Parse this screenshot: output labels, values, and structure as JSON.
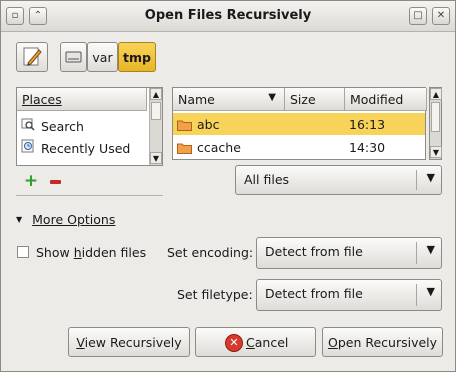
{
  "window": {
    "title": "Open Files Recursively"
  },
  "path_bar": {
    "buttons": [
      "var",
      "tmp"
    ]
  },
  "places": {
    "header": "Places",
    "items": [
      {
        "label": "Search",
        "icon": "search-icon"
      },
      {
        "label": "Recently Used",
        "icon": "clock-icon"
      }
    ]
  },
  "files": {
    "columns": [
      "Name",
      "Size",
      "Modified"
    ],
    "rows": [
      {
        "name": "abc",
        "size": "",
        "modified": "16:13",
        "selected": true
      },
      {
        "name": "ccache",
        "size": "",
        "modified": "14:30",
        "selected": false
      }
    ]
  },
  "filter": {
    "value": "All files"
  },
  "more_options": {
    "label": "More Options"
  },
  "show_hidden": {
    "pre": "Show ",
    "u": "h",
    "post": "idden files",
    "checked": false
  },
  "encoding": {
    "label": "Set encoding:",
    "value": "Detect from file"
  },
  "filetype": {
    "label": "Set filetype:",
    "value": "Detect from file"
  },
  "buttons": {
    "view": {
      "u": "V",
      "rest": "iew Recursively"
    },
    "cancel": {
      "u": "C",
      "rest": "ancel"
    },
    "open": {
      "u": "O",
      "rest": "pen Recursively"
    }
  },
  "colors": {
    "selected_row": "#f8d35a",
    "add": "#2e9e2e",
    "remove": "#c62828",
    "cancel": "#d63a2e"
  }
}
